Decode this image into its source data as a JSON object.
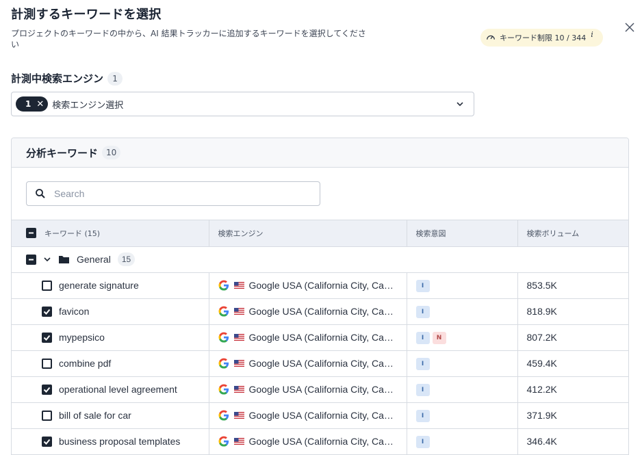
{
  "dialog": {
    "title": "計測するキーワードを選択",
    "subtitle": "プロジェクトのキーワードの中から、AI 結果トラッカーに追加するキーワードを選択してください",
    "limit_label": "キーワード制限 10 / 344",
    "limit_info": "i"
  },
  "engines": {
    "label": "計測中検索エンジン",
    "count": "1",
    "chip_count": "1",
    "chip_remove": "✕",
    "placeholder": "検索エンジン選択"
  },
  "keywords_panel": {
    "title": "分析キーワード",
    "count": "10",
    "search_placeholder": "Search",
    "columns": {
      "keyword": "キーワード (15)",
      "engine": "検索エンジン",
      "intent": "検索意図",
      "volume": "検索ボリューム"
    },
    "group": {
      "name": "General",
      "count": "15"
    },
    "rows": [
      {
        "keyword": "generate signature",
        "checked": false,
        "engine": "Google USA (California City, California, United States)",
        "intents": [
          "I"
        ],
        "volume": "853.5K"
      },
      {
        "keyword": "favicon",
        "checked": true,
        "engine": "Google USA (California City, California, United States)",
        "intents": [
          "I"
        ],
        "volume": "818.9K"
      },
      {
        "keyword": "mypepsico",
        "checked": true,
        "engine": "Google USA (California City, California, United States)",
        "intents": [
          "I",
          "N"
        ],
        "volume": "807.2K"
      },
      {
        "keyword": "combine pdf",
        "checked": false,
        "engine": "Google USA (California City, California, United States)",
        "intents": [
          "I"
        ],
        "volume": "459.4K"
      },
      {
        "keyword": "operational level agreement",
        "checked": true,
        "engine": "Google USA (California City, California, United States)",
        "intents": [
          "I"
        ],
        "volume": "412.2K"
      },
      {
        "keyword": "bill of sale for car",
        "checked": false,
        "engine": "Google USA (California City, California, United States)",
        "intents": [
          "I"
        ],
        "volume": "371.9K"
      },
      {
        "keyword": "business proposal templates",
        "checked": true,
        "engine": "Google USA (California City, California, United States)",
        "intents": [
          "I"
        ],
        "volume": "346.4K"
      }
    ]
  },
  "colors": {
    "dark": "#1d2633",
    "intent_I": "#d9e6f7",
    "intent_N": "#fbdede",
    "limit_badge": "#fcf6dc"
  },
  "icons": [
    "gauge-icon",
    "close-icon",
    "chevron-down-icon",
    "search-icon",
    "folder-icon",
    "google-icon",
    "us-flag-icon",
    "checkbox-icon"
  ]
}
